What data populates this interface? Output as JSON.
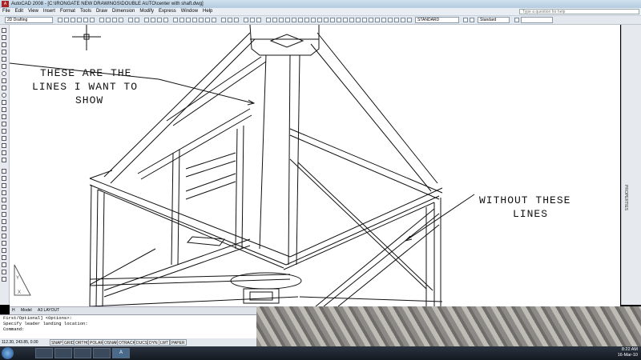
{
  "window": {
    "app_title": "AutoCAD 2008 - [C:\\IRONGATE NEW DRAWINGS\\DOUBLE AUTO\\center with shaft.dwg]"
  },
  "menu": [
    "File",
    "Edit",
    "View",
    "Insert",
    "Format",
    "Tools",
    "Draw",
    "Dimension",
    "Modify",
    "Express",
    "Window",
    "Help"
  ],
  "help_search_placeholder": "Type a question for help",
  "toolbar": {
    "workspace": "2D Drafting",
    "text_style": "STANDARD",
    "dim_style": "Standard"
  },
  "annotations": {
    "callout_left": [
      "THESE ARE THE",
      "LINES I WANT TO",
      "SHOW"
    ],
    "callout_right": [
      "WITHOUT THESE",
      "LINES"
    ]
  },
  "right_palette_label": "PROPERTIES",
  "layout_tabs": [
    "H",
    "Model",
    "A3 LAYOUT"
  ],
  "command_lines": [
    "First/Optional] <Options>:",
    "Specify leader landing location:",
    "Command:"
  ],
  "status": {
    "coords": "112.30, 243.85, 0.00",
    "buttons": [
      "SNAP",
      "GRID",
      "ORTHO",
      "POLAR",
      "OSNAP",
      "OTRACK",
      "DUCS",
      "DYN",
      "LWT",
      "PAPER"
    ]
  },
  "taskbar": {
    "time": "8:22 AM",
    "date": "16-Mar-10"
  },
  "icons": [
    "autocad-icon",
    "start-icon",
    "crosshair-icon",
    "ucs-icon"
  ]
}
